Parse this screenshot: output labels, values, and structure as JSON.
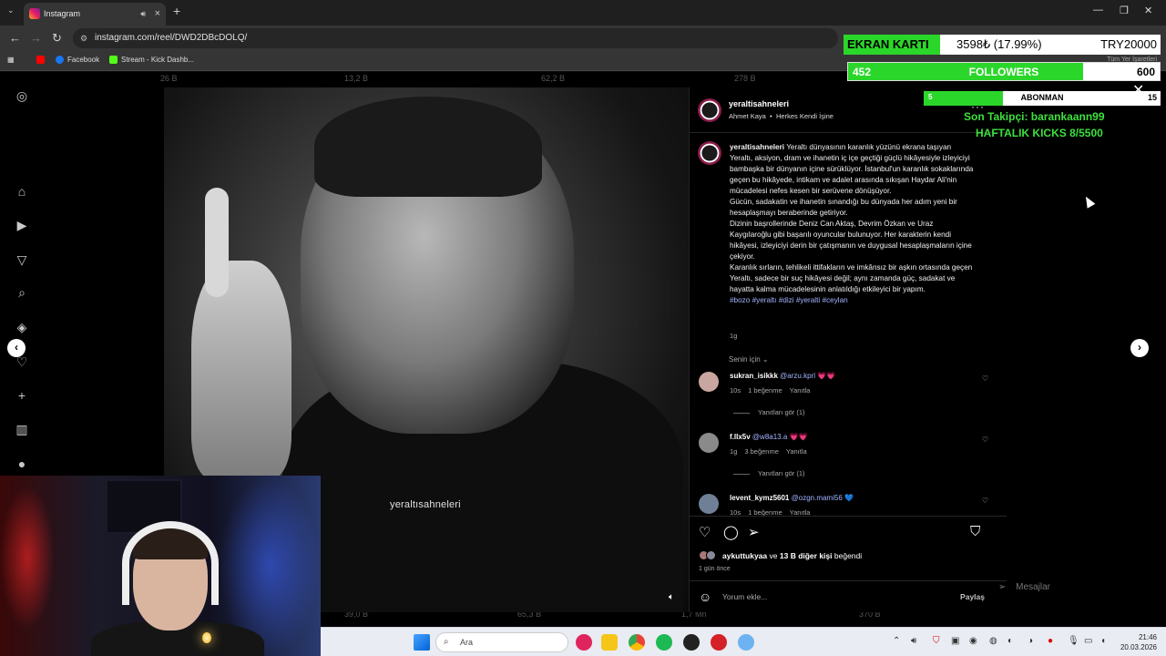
{
  "browser": {
    "tab_title": "Instagram",
    "url": "instagram.com/reel/DWD2DBcDOLQ/",
    "bookmarks": [
      {
        "label": "",
        "color": "#ff0000"
      },
      {
        "label": "Facebook",
        "color": "#1877f2"
      },
      {
        "label": "Stream - Kick Dashb...",
        "color": "#53fc18"
      }
    ],
    "all_bookmarks": "Tüm Yer İşaretleri"
  },
  "background_views": [
    "26 B",
    "13,2 B",
    "62,2 B",
    "278 B"
  ],
  "background_views_bottom": [
    "39,0 B",
    "65,3 B",
    "1,7 Mn",
    "370 B"
  ],
  "video": {
    "watermark": "yeraltısahneleri"
  },
  "post": {
    "username": "yeraltisahneleri",
    "author": "Ahmet Kaya",
    "song": "Herkes Kendi İşine",
    "caption_user": "yeraltisahneleri",
    "caption": "Yeraltı dünyasının karanlık yüzünü ekrana taşıyan Yeraltı, aksiyon, dram ve ihanetin iç içe geçtiği güçlü hikâyesiyle izleyiciyi bambaşka bir dünyanın içine sürüklüyor. İstanbul'un karanlık sokaklarında geçen bu hikâyede, intikam ve adalet arasında sıkışan Haydar Ali'nin mücadelesi nefes kesen bir serüvene dönüşüyor.",
    "caption_p2": "Gücün, sadakatin ve ihanetin sınandığı bu dünyada her adım yeni bir hesaplaşmayı beraberinde getiriyor.",
    "caption_p3": "Dizinin başrollerinde Deniz Can Aktaş, Devrim Özkan ve Uraz Kaygılaroğlu gibi başarılı oyuncular bulunuyor. Her karakterin kendi hikâyesi, izleyiciyi derin bir çatışmanın ve duygusal hesaplaşmaların içine çekiyor.",
    "caption_p4": "Karanlık sırların, tehlikeli ittifakların ve imkânsız bir aşkın ortasında geçen Yeraltı, sadece bir suç hikâyesi değil; aynı zamanda güç, sadakat ve hayatta kalma mücadelesinin anlatıldığı etkileyici bir yapım.",
    "hashtags": "#bozo #yeraltı #dizi #yeralti #ceylan",
    "caption_time": "1g",
    "for_you": "Senin için",
    "comments": [
      {
        "user": "sukran_isikkk",
        "mention": "@arzu.kprl",
        "emoji": "💗💗",
        "time": "10s",
        "likes": "1 beğenme",
        "reply": "Yanıtla",
        "replies": "Yanıtları gör (1)",
        "avatar": "#c9a7a0"
      },
      {
        "user": "f.llx5v",
        "mention": "@w8a13.a",
        "emoji": "💗💗",
        "time": "1g",
        "likes": "3 beğenme",
        "reply": "Yanıtla",
        "replies": "Yanıtları gör (1)",
        "avatar": "#8a8a8a"
      },
      {
        "user": "levent_kymz5601",
        "mention": "@ozgn.mami56",
        "emoji": "💙",
        "time": "10s",
        "likes": "1 beğenme",
        "reply": "Yanıtla",
        "replies": "",
        "avatar": "#6f7f95"
      }
    ],
    "liked_by_user": "aykuttukyaa",
    "liked_by_conj": "ve",
    "liked_by_others": "13 B diğer kişi",
    "liked_by_verb": "beğendi",
    "post_time": "1 gün önce",
    "comment_placeholder": "Yorum ekle...",
    "post_button": "Paylaş"
  },
  "messages_label": "Mesajlar",
  "overlay": {
    "gpu_label": "EKRAN KARTI",
    "gpu_amount": "3598₺ (17.99%)",
    "gpu_target": "TRY20000",
    "gpu_progress": 0.1799,
    "followers_current": "452",
    "followers_label": "FOLLOWERS",
    "followers_target": "600",
    "followers_progress": 0.7533,
    "subs_current": "5",
    "subs_label": "ABONMAN",
    "subs_target": "15",
    "subs_progress": 0.3333,
    "last_follower": "Son Takipçi: barankaann99",
    "weekly_kicks": "HAFTALIK KICKS 8/5500"
  },
  "taskbar": {
    "search_label": "Ara",
    "time": "21:46",
    "date": "20.03.2026"
  }
}
